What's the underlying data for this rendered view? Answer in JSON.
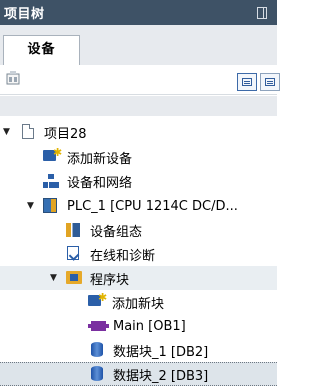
{
  "panel": {
    "title": "项目树"
  },
  "tabs": [
    {
      "label": "设备"
    }
  ],
  "tree": {
    "project": {
      "label": "项目28"
    },
    "add_device": {
      "label": "添加新设备"
    },
    "devices_networks": {
      "label": "设备和网络"
    },
    "plc": {
      "label": "PLC_1 [CPU 1214C DC/D..."
    },
    "device_config": {
      "label": "设备组态"
    },
    "online_diag": {
      "label": "在线和诊断"
    },
    "program_blocks": {
      "label": "程序块"
    },
    "add_block": {
      "label": "添加新块"
    },
    "main_ob": {
      "label": "Main [OB1]"
    },
    "db1": {
      "label": "数据块_1 [DB2]"
    },
    "db2": {
      "label": "数据块_2 [DB3]"
    }
  }
}
